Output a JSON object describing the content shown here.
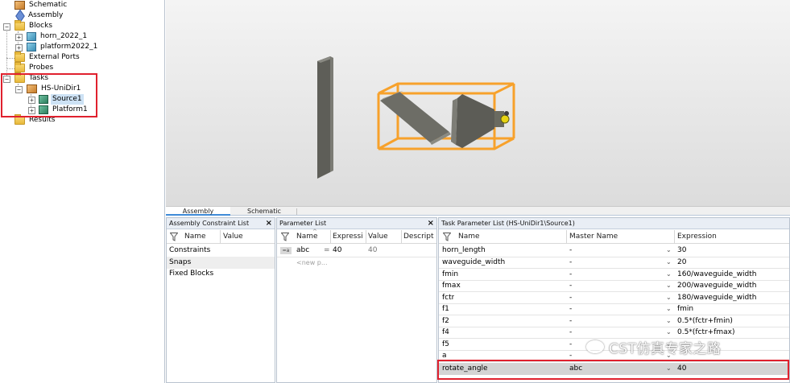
{
  "tree": {
    "items": [
      {
        "label": "Schematic"
      },
      {
        "label": "Assembly"
      },
      {
        "label": "Blocks"
      },
      {
        "label": "horn_2022_1"
      },
      {
        "label": "platform2022_1"
      },
      {
        "label": "External Ports"
      },
      {
        "label": "Probes"
      },
      {
        "label": "Tasks"
      },
      {
        "label": "HS-UniDir1"
      },
      {
        "label": "Source1"
      },
      {
        "label": "Platform1"
      },
      {
        "label": "Results"
      }
    ]
  },
  "view_tabs": [
    {
      "label": "Assembly"
    },
    {
      "label": "Schematic"
    }
  ],
  "assembly_constraint": {
    "title": "Assembly Constraint List",
    "close": "×",
    "headers": {
      "name": "Name",
      "value": "Value"
    },
    "rows": [
      {
        "name": "Constraints"
      },
      {
        "name": "Snaps"
      },
      {
        "name": "Fixed Blocks"
      }
    ]
  },
  "parameter_list": {
    "title": "Parameter List",
    "close": "×",
    "headers": {
      "name": "Name",
      "expression": "Expressi",
      "value": "Value",
      "description": "Descript"
    },
    "rows": [
      {
        "name": "abc",
        "eq": "=",
        "expression": "40",
        "value": "40"
      }
    ],
    "new_row": "<new p..."
  },
  "task_parameter_list": {
    "title": "Task Parameter List (HS-UniDir1\\Source1)",
    "headers": {
      "name": "Name",
      "master": "Master Name",
      "expression": "Expression"
    },
    "rows": [
      {
        "name": "horn_length",
        "master": "-",
        "expression": "30"
      },
      {
        "name": "waveguide_width",
        "master": "-",
        "expression": "20"
      },
      {
        "name": "fmin",
        "master": "-",
        "expression": "160/waveguide_width"
      },
      {
        "name": "fmax",
        "master": "-",
        "expression": "200/waveguide_width"
      },
      {
        "name": "fctr",
        "master": "-",
        "expression": "180/waveguide_width"
      },
      {
        "name": "f1",
        "master": "-",
        "expression": "fmin"
      },
      {
        "name": "f2",
        "master": "-",
        "expression": "0.5*(fctr+fmin)"
      },
      {
        "name": "f4",
        "master": "-",
        "expression": "0.5*(fctr+fmax)"
      },
      {
        "name": "f5",
        "master": "-",
        "expression": ""
      },
      {
        "name": "a",
        "master": "-",
        "expression": ""
      },
      {
        "name": "rotate_angle",
        "master": "abc",
        "expression": "40"
      }
    ]
  },
  "watermark": "CST仿真专家之路",
  "colors": {
    "highlight_red": "#e0212e",
    "selection_bar": "#cde2f5",
    "orange_bbox": "#f7a12b"
  },
  "icons": {
    "filter": "filter-icon",
    "folder": "folder-icon",
    "block": "block-icon",
    "source": "source-icon"
  }
}
